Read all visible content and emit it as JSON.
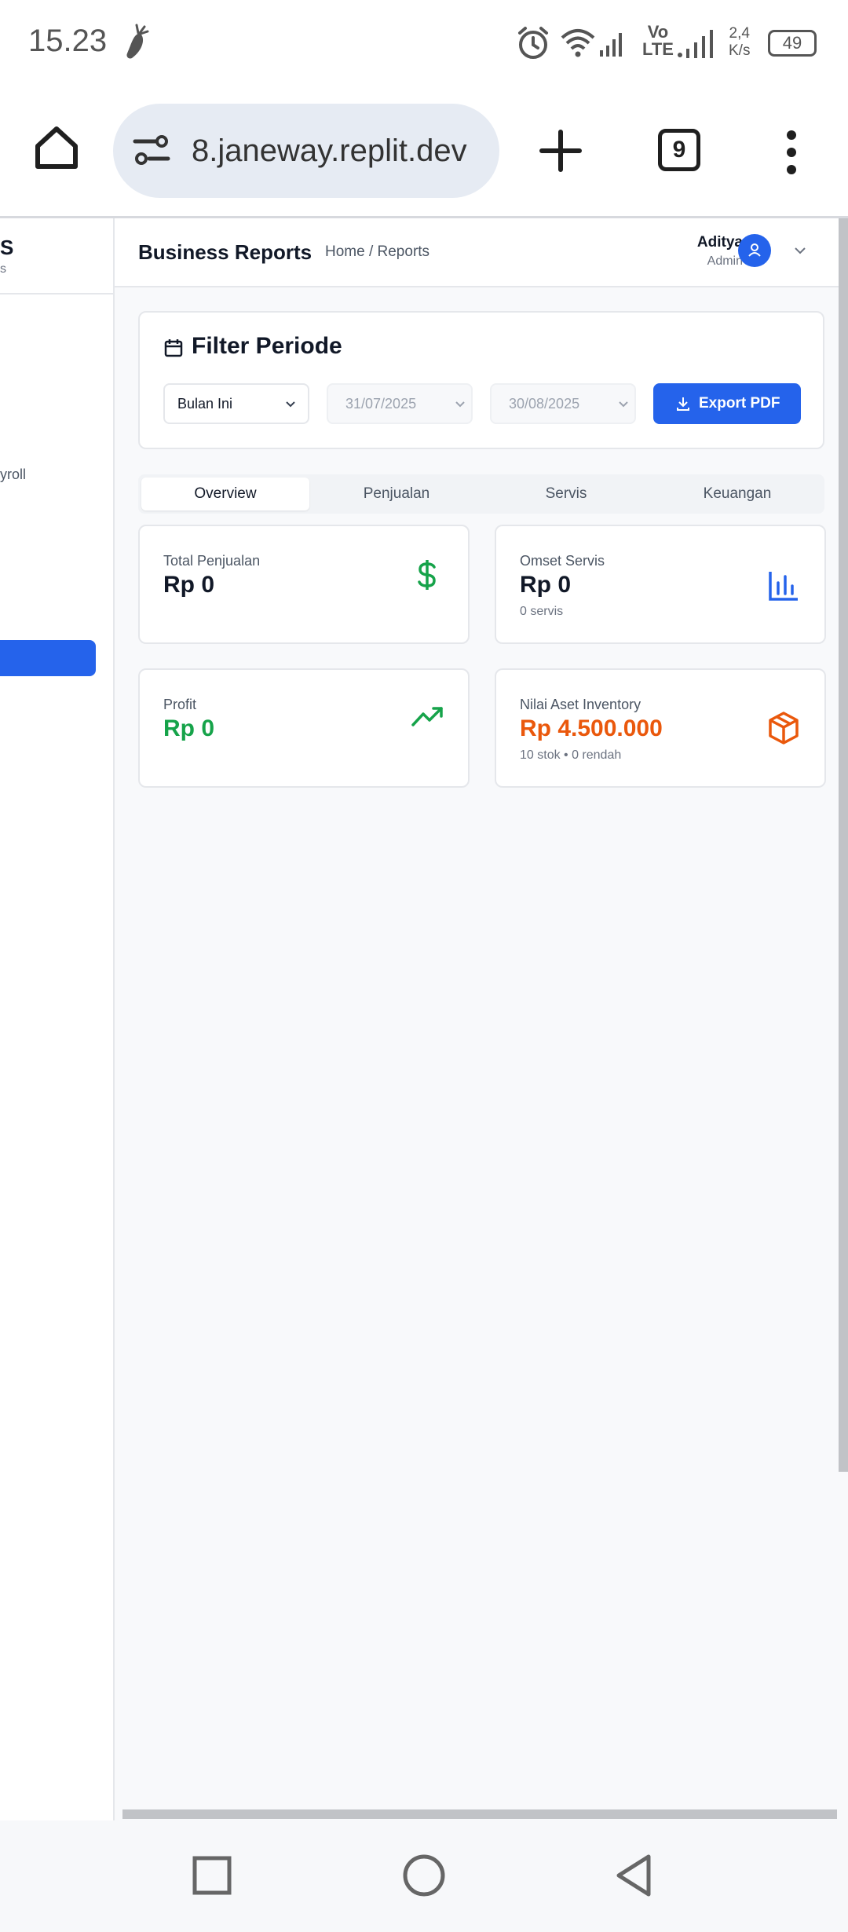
{
  "status": {
    "time": "15.23",
    "network_speed_value": "2,4",
    "network_speed_unit": "K/s",
    "volte_top": "Vo",
    "volte_bottom": "LTE",
    "battery": "49"
  },
  "browser": {
    "url": "8.janeway.replit.dev",
    "tab_count": "9"
  },
  "sidebar": {
    "title_fragment": "S",
    "subtitle_fragment": "s",
    "item_fragment": "yroll"
  },
  "header": {
    "title": "Business Reports",
    "breadcrumb": "Home / Reports",
    "user_name": "Aditya",
    "user_role": "Admin"
  },
  "filter": {
    "title": "Filter Periode",
    "period_value": "Bulan Ini",
    "date_from": "31/07/2025",
    "date_to": "30/08/2025",
    "export_label": "Export PDF"
  },
  "tabs": [
    {
      "label": "Overview",
      "active": true
    },
    {
      "label": "Penjualan",
      "active": false
    },
    {
      "label": "Servis",
      "active": false
    },
    {
      "label": "Keuangan",
      "active": false
    }
  ],
  "stats": {
    "total_penjualan": {
      "label": "Total Penjualan",
      "value": "Rp 0",
      "icon": "dollar-icon"
    },
    "omset_servis": {
      "label": "Omset Servis",
      "value": "Rp 0",
      "sub": "0 servis",
      "icon": "bar-chart-icon"
    },
    "profit": {
      "label": "Profit",
      "value": "Rp 0",
      "icon": "trending-up-icon"
    },
    "nilai_aset": {
      "label": "Nilai Aset Inventory",
      "value": "Rp 4.500.000",
      "sub": "10 stok • 0 rendah",
      "icon": "package-icon"
    }
  },
  "colors": {
    "primary": "#2563eb",
    "success": "#16a34a",
    "warning": "#ea580c"
  }
}
